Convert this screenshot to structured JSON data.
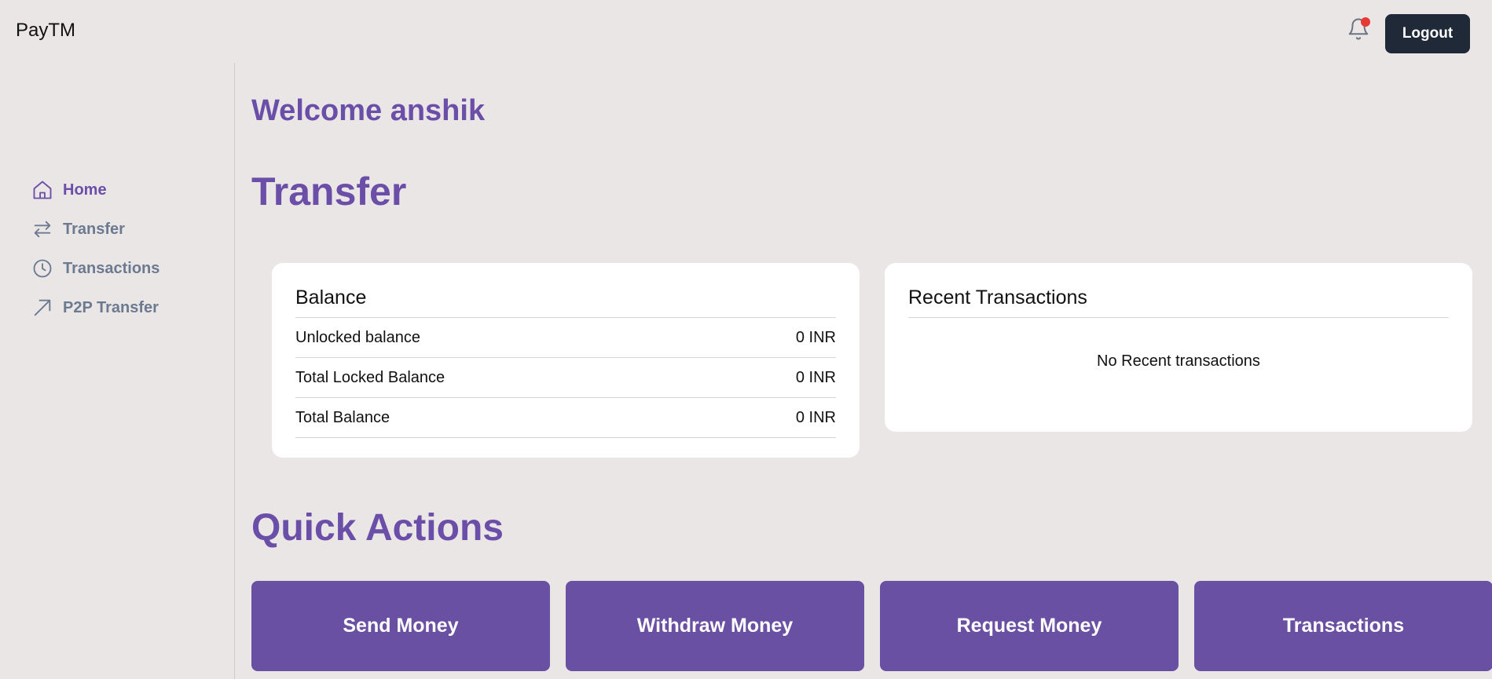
{
  "header": {
    "brand": "PayTM",
    "logout_label": "Logout",
    "bell_icon": "bell-icon"
  },
  "sidebar": {
    "items": [
      {
        "label": "Home",
        "icon": "home-icon",
        "active": true
      },
      {
        "label": "Transfer",
        "icon": "transfer-icon",
        "active": false
      },
      {
        "label": "Transactions",
        "icon": "clock-icon",
        "active": false
      },
      {
        "label": "P2P Transfer",
        "icon": "arrow-up-right-icon",
        "active": false
      }
    ]
  },
  "main": {
    "welcome": "Welcome anshik",
    "title": "Transfer",
    "balance": {
      "title": "Balance",
      "rows": [
        {
          "label": "Unlocked balance",
          "value": "0 INR"
        },
        {
          "label": "Total Locked Balance",
          "value": "0 INR"
        },
        {
          "label": "Total Balance",
          "value": "0 INR"
        }
      ]
    },
    "recent": {
      "title": "Recent Transactions",
      "empty": "No Recent transactions"
    },
    "quick_actions": {
      "title": "Quick Actions",
      "buttons": [
        "Send Money",
        "Withdraw Money",
        "Request Money",
        "Transactions"
      ]
    }
  },
  "colors": {
    "accent": "#6a4ea8",
    "button": "#6a50a3",
    "logout_bg": "#1f2937",
    "background": "#ebe6e6"
  }
}
